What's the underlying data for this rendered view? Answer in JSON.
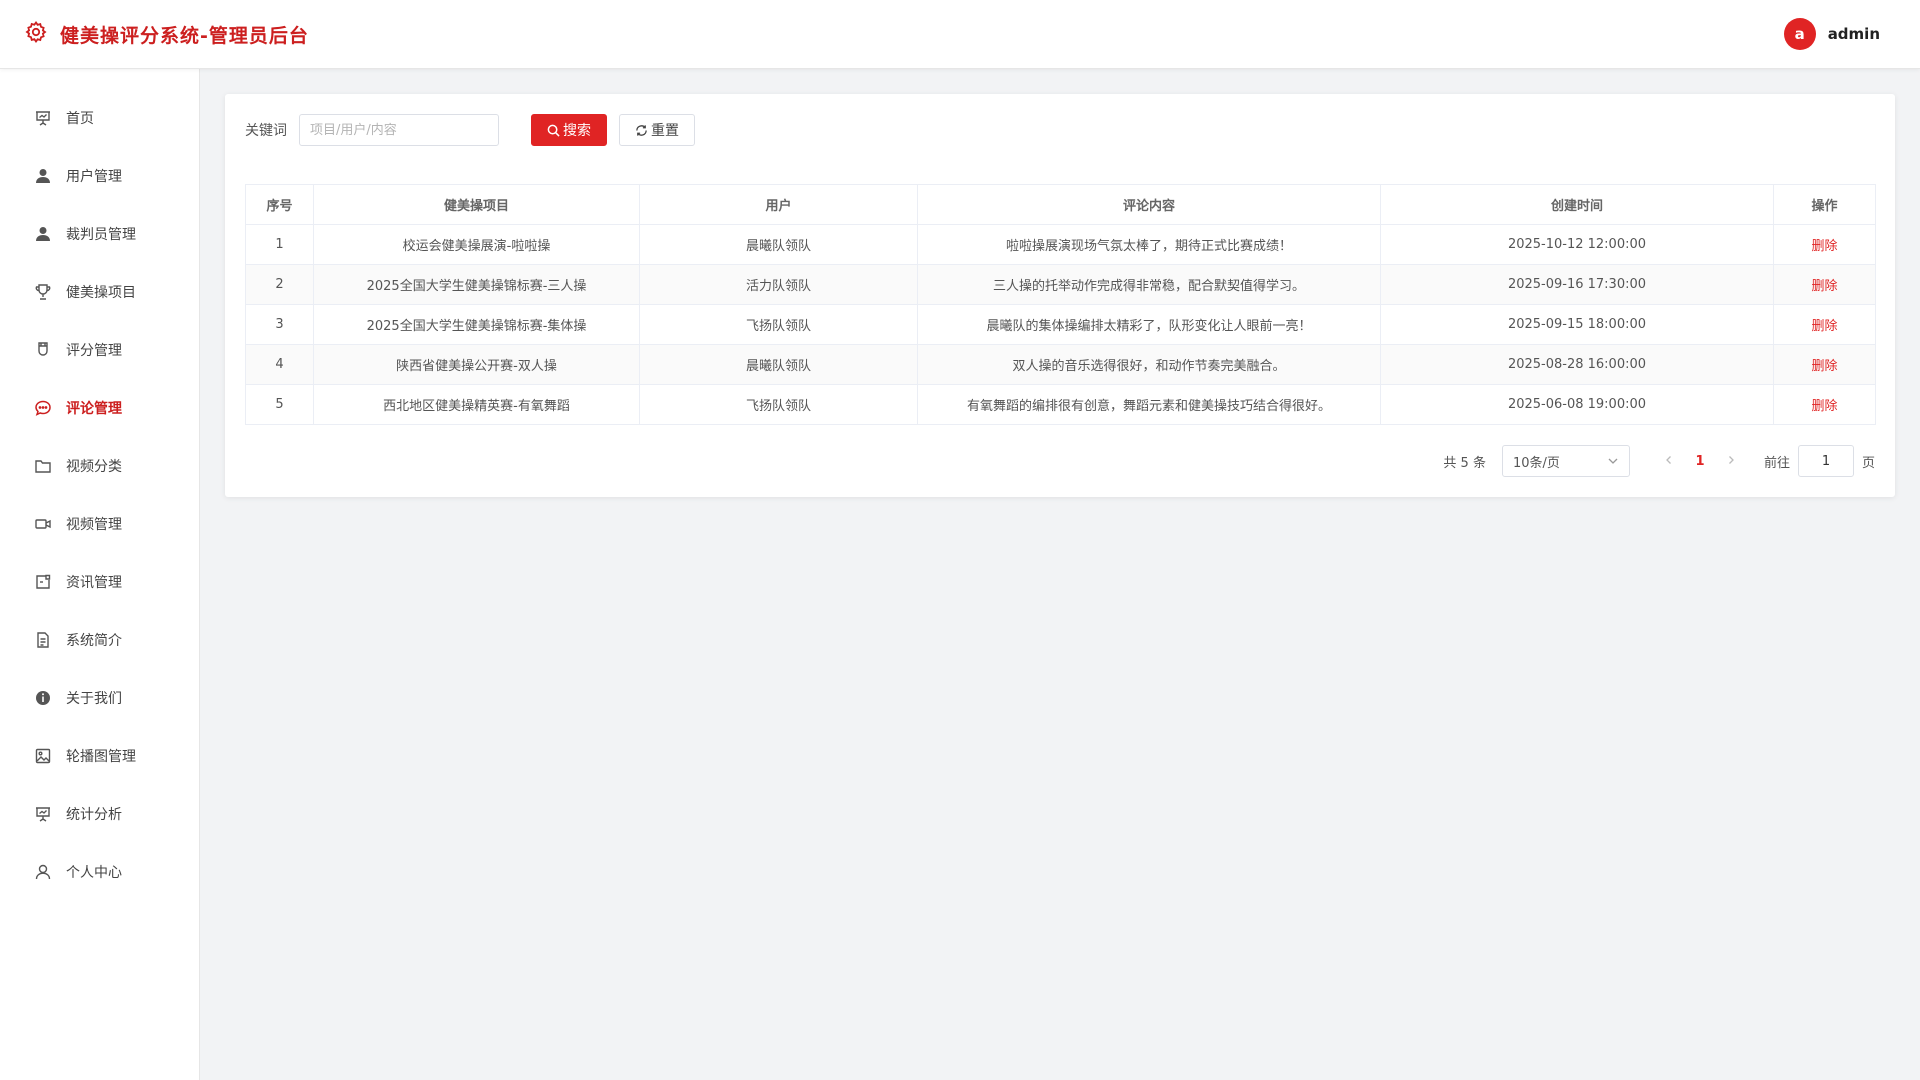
{
  "header": {
    "title": "健美操评分系统-管理员后台",
    "avatar_letter": "a",
    "username": "admin",
    "accent_color": "#cc1f1f"
  },
  "sidebar": {
    "items": [
      {
        "label": "首页",
        "icon": "presentation-chart-icon",
        "active": false
      },
      {
        "label": "用户管理",
        "icon": "user-icon",
        "active": false
      },
      {
        "label": "裁判员管理",
        "icon": "user-icon",
        "active": false
      },
      {
        "label": "健美操项目",
        "icon": "trophy-icon",
        "active": false
      },
      {
        "label": "评分管理",
        "icon": "cup-icon",
        "active": false
      },
      {
        "label": "评论管理",
        "icon": "chat-bubble-icon",
        "active": true
      },
      {
        "label": "视频分类",
        "icon": "folder-icon",
        "active": false
      },
      {
        "label": "视频管理",
        "icon": "video-camera-icon",
        "active": false
      },
      {
        "label": "资讯管理",
        "icon": "news-icon",
        "active": false
      },
      {
        "label": "系统简介",
        "icon": "document-icon",
        "active": false
      },
      {
        "label": "关于我们",
        "icon": "info-icon",
        "active": false
      },
      {
        "label": "轮播图管理",
        "icon": "picture-icon",
        "active": false
      },
      {
        "label": "统计分析",
        "icon": "presentation-chart-icon",
        "active": false
      },
      {
        "label": "个人中心",
        "icon": "user-outline-icon",
        "active": false
      }
    ]
  },
  "search": {
    "label": "关键词",
    "placeholder": "项目/用户/内容",
    "value": "",
    "search_button": "搜索",
    "reset_button": "重置"
  },
  "table": {
    "columns": [
      "序号",
      "健美操项目",
      "用户",
      "评论内容",
      "创建时间",
      "操作"
    ],
    "rows": [
      {
        "index": "1",
        "project": "校运会健美操展演-啦啦操",
        "user": "晨曦队领队",
        "content": "啦啦操展演现场气氛太棒了，期待正式比赛成绩！",
        "created": "2025-10-12 12:00:00",
        "action": "删除"
      },
      {
        "index": "2",
        "project": "2025全国大学生健美操锦标赛-三人操",
        "user": "活力队领队",
        "content": "三人操的托举动作完成得非常稳，配合默契值得学习。",
        "created": "2025-09-16 17:30:00",
        "action": "删除"
      },
      {
        "index": "3",
        "project": "2025全国大学生健美操锦标赛-集体操",
        "user": "飞扬队领队",
        "content": "晨曦队的集体操编排太精彩了，队形变化让人眼前一亮！",
        "created": "2025-09-15 18:00:00",
        "action": "删除"
      },
      {
        "index": "4",
        "project": "陕西省健美操公开赛-双人操",
        "user": "晨曦队领队",
        "content": "双人操的音乐选得很好，和动作节奏完美融合。",
        "created": "2025-08-28 16:00:00",
        "action": "删除"
      },
      {
        "index": "5",
        "project": "西北地区健美操精英赛-有氧舞蹈",
        "user": "飞扬队领队",
        "content": "有氧舞蹈的编排很有创意，舞蹈元素和健美操技巧结合得很好。",
        "created": "2025-06-08 19:00:00",
        "action": "删除"
      }
    ]
  },
  "pagination": {
    "total_text": "共 5 条",
    "page_size": "10条/页",
    "current_page": "1",
    "goto_label": "前往",
    "goto_value": "1",
    "page_suffix": "页"
  }
}
